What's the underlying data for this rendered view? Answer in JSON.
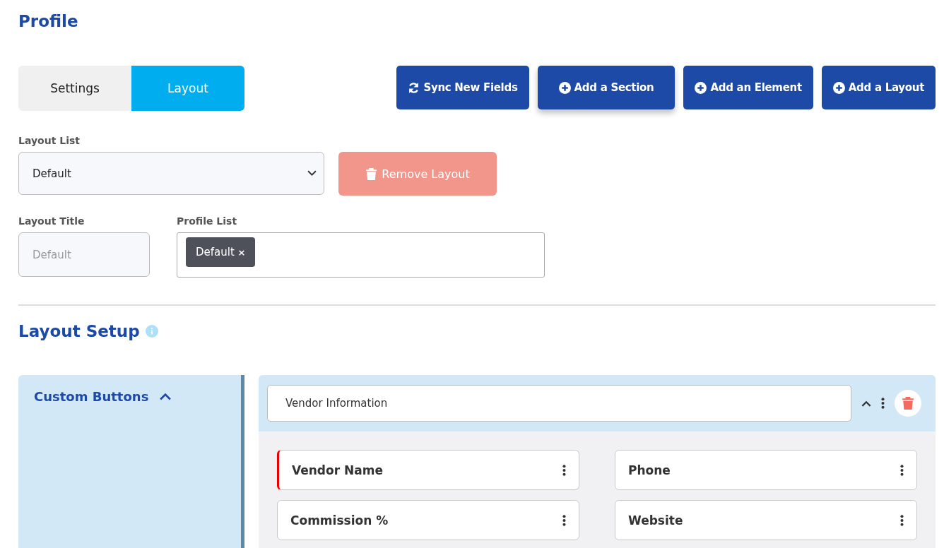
{
  "page_title": "Profile",
  "tabs": [
    {
      "label": "Settings",
      "selected": false
    },
    {
      "label": "Layout",
      "selected": true
    }
  ],
  "actions": [
    {
      "label": "Sync New Fields",
      "kind": "sync",
      "focused": false
    },
    {
      "label": "Add a Section",
      "kind": "add",
      "focused": true
    },
    {
      "label": "Add an Element",
      "kind": "add",
      "focused": false
    },
    {
      "label": "Add a Layout",
      "kind": "add",
      "focused": false
    }
  ],
  "layout_list": {
    "label": "Layout List",
    "value": "Default"
  },
  "remove_button": {
    "label": "Remove Layout",
    "disabled": true
  },
  "layout_title": {
    "label": "Layout Title",
    "placeholder": "Default"
  },
  "profile_list": {
    "label": "Profile List",
    "tags": [
      "Default"
    ],
    "tag_remove": "×"
  },
  "setup": {
    "title": "Layout Setup",
    "sidebar": {
      "title": "Custom Buttons",
      "expanded": true
    },
    "section": {
      "name": "Vendor Information",
      "expanded": true,
      "elements": [
        {
          "label": "Vendor Name",
          "required": true
        },
        {
          "label": "Phone",
          "required": false
        },
        {
          "label": "Commission %",
          "required": false
        },
        {
          "label": "Website",
          "required": false
        }
      ]
    }
  }
}
